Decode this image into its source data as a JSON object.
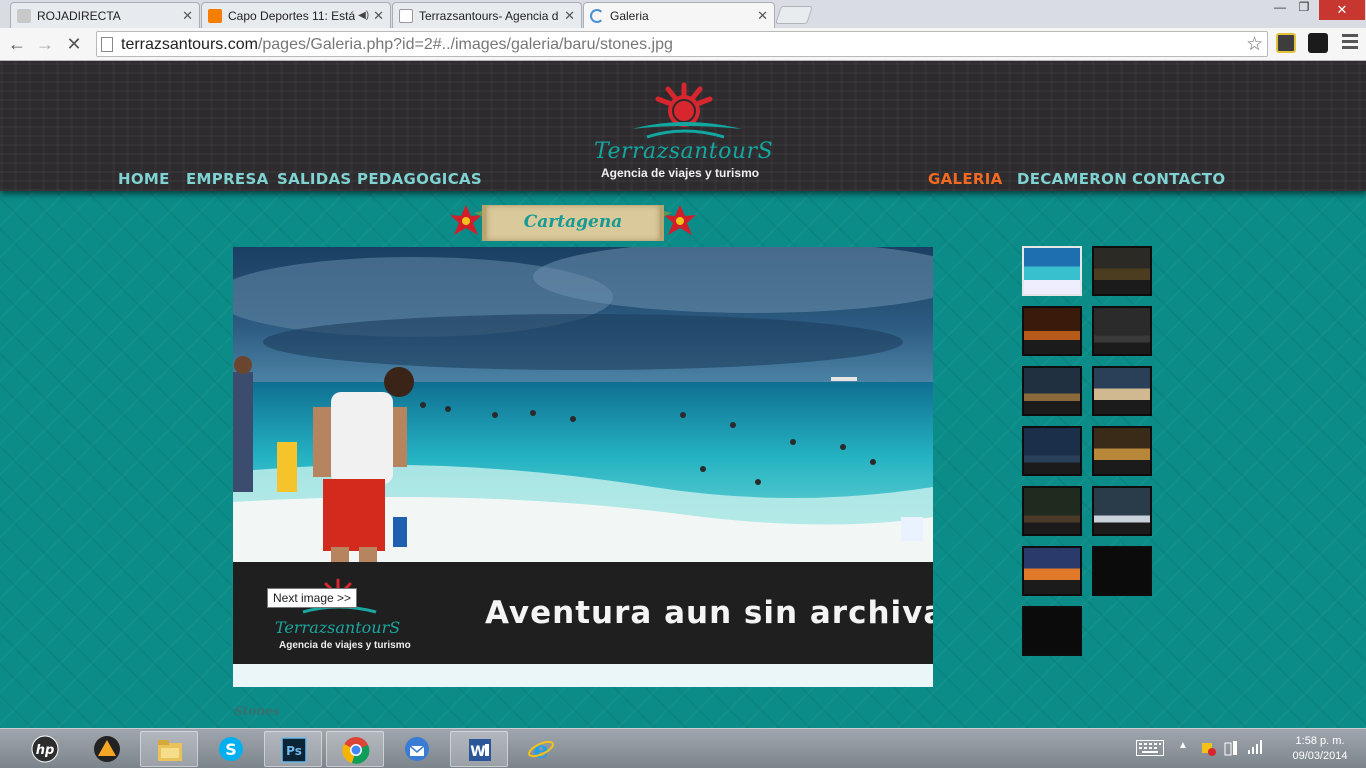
{
  "browser": {
    "tabs": [
      {
        "title": "ROJADIRECTA",
        "active": false
      },
      {
        "title": "Capo Deportes 11: Está",
        "active": false
      },
      {
        "title": "Terrazsantours- Agencia d",
        "active": false
      },
      {
        "title": "Galeria",
        "active": true
      }
    ],
    "url_host": "terrazsantours.com",
    "url_path": "/pages/Galeria.php?id=2#../images/galeria/baru/stones.jpg"
  },
  "site": {
    "logo_brand": "TerrazsantourS",
    "logo_tagline": "Agencia de viajes y turismo",
    "nav_left": [
      "HOME",
      "EMPRESA",
      "SALIDAS PEDAGOGICAS"
    ],
    "nav_right": [
      "GALERIA",
      "DECAMERON",
      "CONTACTO"
    ],
    "active_nav": "GALERIA",
    "section_title": "Cartagena",
    "banner_text": "Aventura aun sin archivar",
    "banner_brand": "TerrazsantourS",
    "banner_tagline": "Agencia de viajes y turismo",
    "tooltip": "Next image >>",
    "caption": "Stones",
    "thumbnail_count": 13,
    "selected_thumbnail": 1
  },
  "taskbar": {
    "time": "1:58 p. m.",
    "date": "09/03/2014"
  },
  "colors": {
    "page_bg": "#0b8c88",
    "header_bg": "#2d2b2d",
    "nav_text": "#7fd3d2",
    "nav_active": "#f26a22",
    "brand_teal": "#12a7a1"
  }
}
